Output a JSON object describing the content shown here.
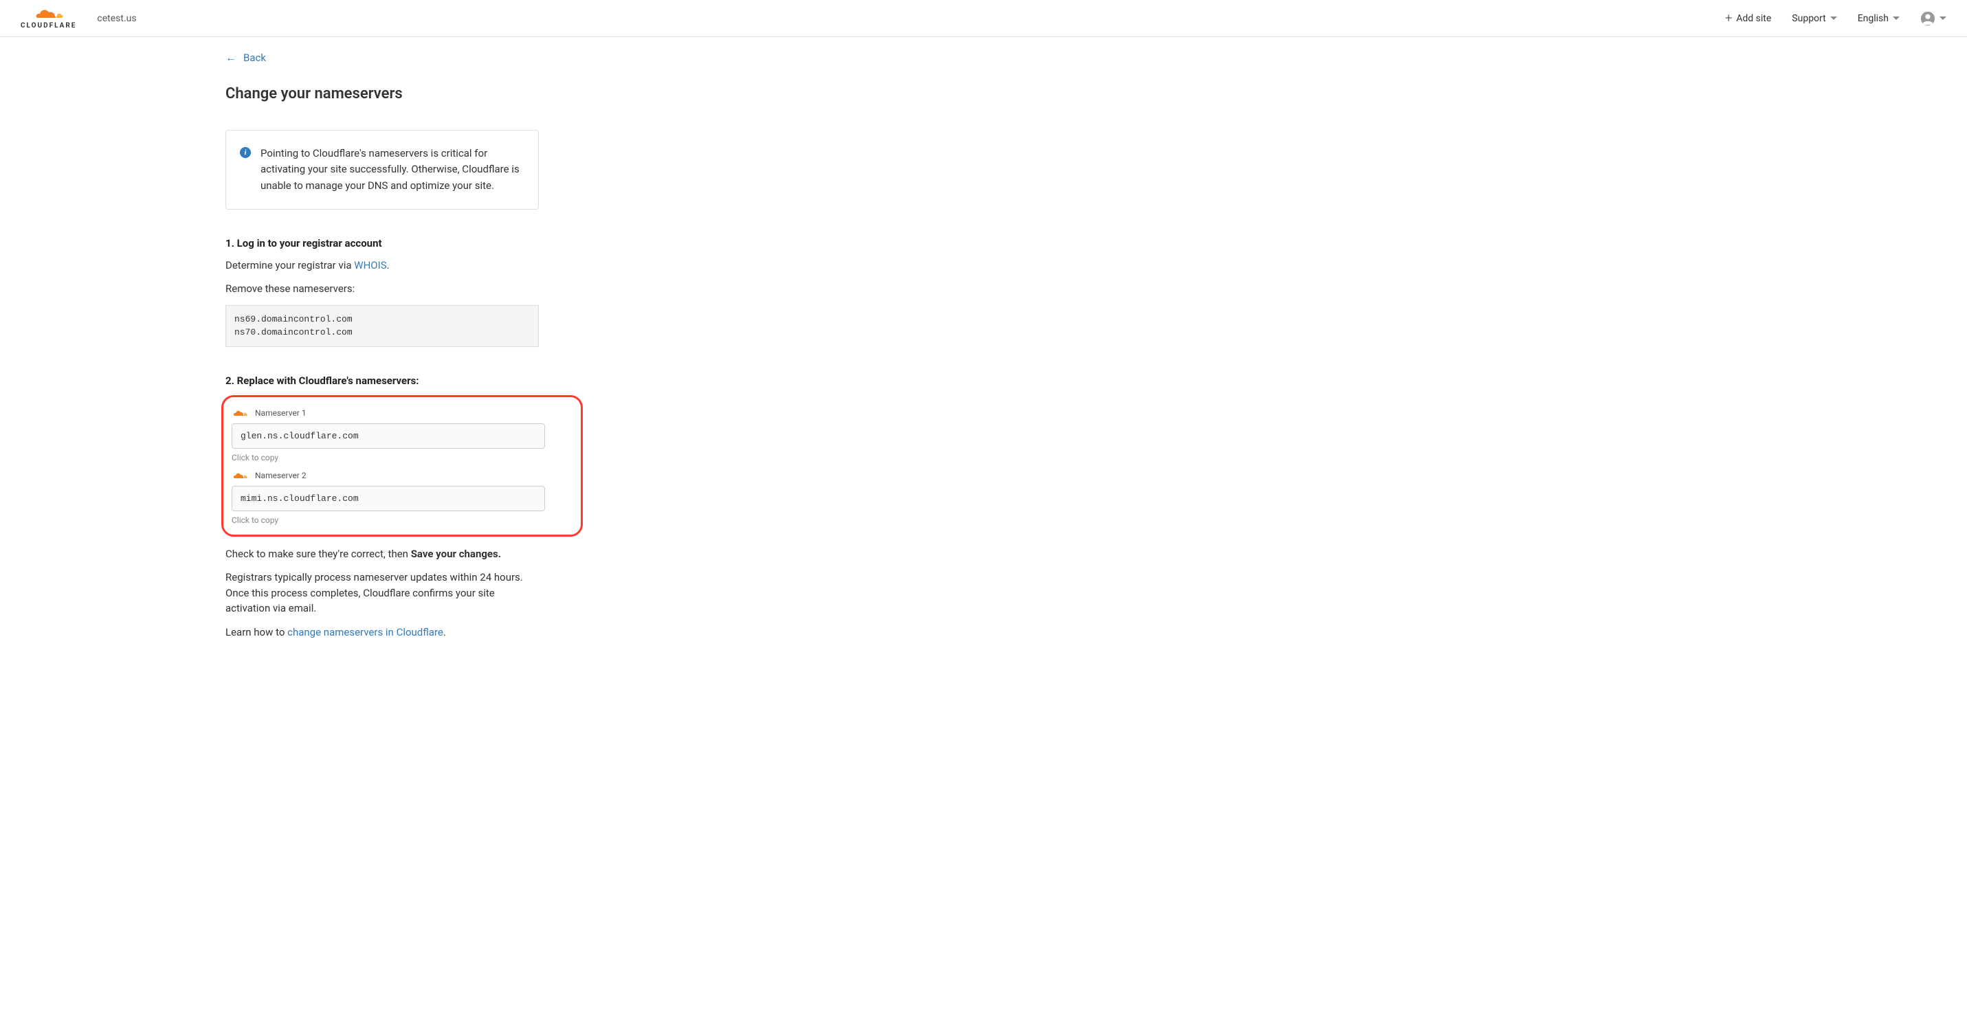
{
  "header": {
    "logo_text": "CLOUDFLARE",
    "domain": "cetest.us",
    "add_site": "Add site",
    "support": "Support",
    "language": "English"
  },
  "main": {
    "back": "Back",
    "title": "Change your nameservers",
    "info": "Pointing to Cloudflare's nameservers is critical for activating your site successfully. Otherwise, Cloudflare is unable to manage your DNS and optimize your site.",
    "step1": {
      "title": "1. Log in to your registrar account",
      "determine_prefix": "Determine your registrar via ",
      "whois": "WHOIS",
      "determine_suffix": ".",
      "remove": "Remove these nameservers:",
      "ns_old": "ns69.domaincontrol.com\nns70.domaincontrol.com"
    },
    "step2": {
      "title": "2. Replace with Cloudflare's nameservers:",
      "ns1_label": "Nameserver 1",
      "ns1_value": "glen.ns.cloudflare.com",
      "ns2_label": "Nameserver 2",
      "ns2_value": "mimi.ns.cloudflare.com",
      "copy_hint": "Click to copy",
      "check_prefix": "Check to make sure they're correct, then ",
      "save_bold": "Save your changes.",
      "registrars": "Registrars typically process nameserver updates within 24 hours. Once this process completes, Cloudflare confirms your site activation via email.",
      "learn_prefix": "Learn how to ",
      "learn_link": "change nameservers in Cloudflare",
      "learn_suffix": "."
    }
  }
}
